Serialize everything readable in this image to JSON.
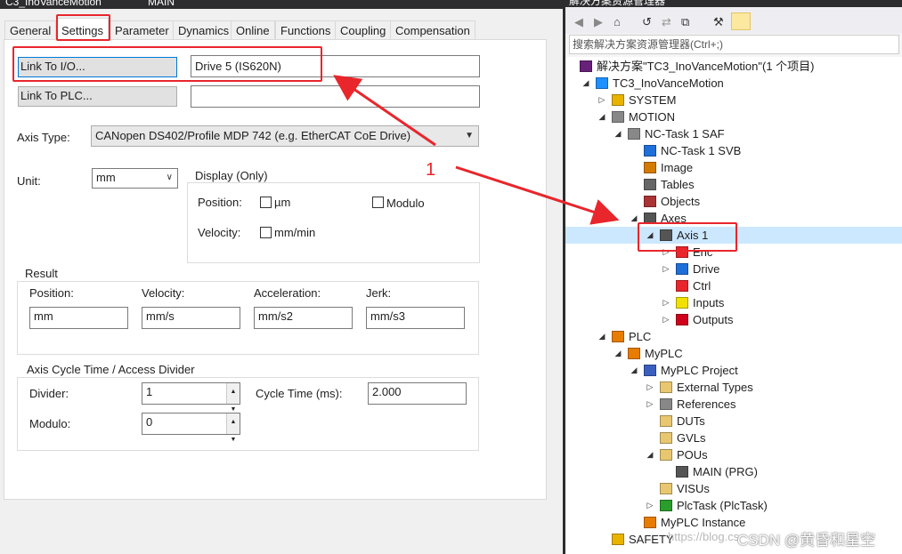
{
  "doc_tabs": [
    "C3_InoVanceMotion",
    "MAIN"
  ],
  "tabs": [
    "General",
    "Settings",
    "Parameter",
    "Dynamics",
    "Online",
    "Functions",
    "Coupling",
    "Compensation"
  ],
  "link_io": {
    "button": "Link To I/O...",
    "value": "Drive 5 (IS620N)"
  },
  "link_plc": {
    "button": "Link To PLC...",
    "value": ""
  },
  "axis_type": {
    "label": "Axis Type:",
    "value": "CANopen DS402/Profile MDP 742 (e.g. EtherCAT CoE Drive)"
  },
  "unit": {
    "label": "Unit:",
    "value": "mm"
  },
  "display": {
    "title": "Display (Only)",
    "position_label": "Position:",
    "um_label": "µm",
    "modulo_label": "Modulo",
    "velocity_label": "Velocity:",
    "mm_min_label": "mm/min"
  },
  "result": {
    "title": "Result",
    "headers": [
      "Position:",
      "Velocity:",
      "Acceleration:",
      "Jerk:"
    ],
    "values": [
      "mm",
      "mm/s",
      "mm/s2",
      "mm/s3"
    ]
  },
  "cycle": {
    "title": "Axis Cycle Time / Access Divider",
    "divider_label": "Divider:",
    "divider_value": "1",
    "cycle_time_label": "Cycle Time (ms):",
    "cycle_time_value": "2.000",
    "modulo_label": "Modulo:",
    "modulo_value": "0"
  },
  "annotation_number": "1",
  "solution_explorer": {
    "title": "解决方案资源管理器",
    "search_placeholder": "搜索解决方案资源管理器(Ctrl+;)",
    "tree": [
      {
        "label": "解决方案\"TC3_InoVanceMotion\"(1 个项目)",
        "icon": "solution-icon",
        "color": "#68217a"
      },
      {
        "label": "TC3_InoVanceMotion",
        "icon": "twincat-project-icon",
        "color": "#1e90ff"
      },
      {
        "label": "SYSTEM",
        "icon": "system-icon",
        "color": "#e8b400"
      },
      {
        "label": "MOTION",
        "icon": "motion-icon",
        "color": "#888888"
      },
      {
        "label": "NC-Task 1 SAF",
        "icon": "nc-task-icon",
        "color": "#888888"
      },
      {
        "label": "NC-Task 1 SVB",
        "icon": "nc-task-svb-icon",
        "color": "#1e6fd9"
      },
      {
        "label": "Image",
        "icon": "image-icon",
        "color": "#d47a00"
      },
      {
        "label": "Tables",
        "icon": "tables-icon",
        "color": "#666666"
      },
      {
        "label": "Objects",
        "icon": "objects-icon",
        "color": "#a33"
      },
      {
        "label": "Axes",
        "icon": "axes-icon",
        "color": "#555555"
      },
      {
        "label": "Axis 1",
        "icon": "axis-icon",
        "color": "#555555"
      },
      {
        "label": "Enc",
        "icon": "encoder-icon",
        "color": "#e8262c"
      },
      {
        "label": "Drive",
        "icon": "drive-icon",
        "color": "#1e6fd9"
      },
      {
        "label": "Ctrl",
        "icon": "ctrl-icon",
        "color": "#e8262c"
      },
      {
        "label": "Inputs",
        "icon": "inputs-icon",
        "color": "#f2e000"
      },
      {
        "label": "Outputs",
        "icon": "outputs-icon",
        "color": "#d0021b"
      },
      {
        "label": "PLC",
        "icon": "plc-icon",
        "color": "#e87c00"
      },
      {
        "label": "MyPLC",
        "icon": "myplc-icon",
        "color": "#e87c00"
      },
      {
        "label": "MyPLC Project",
        "icon": "plc-project-icon",
        "color": "#3a5fbf"
      },
      {
        "label": "External Types",
        "icon": "folder-icon",
        "color": "#e8c770"
      },
      {
        "label": "References",
        "icon": "references-icon",
        "color": "#888888"
      },
      {
        "label": "DUTs",
        "icon": "folder-icon",
        "color": "#e8c770"
      },
      {
        "label": "GVLs",
        "icon": "folder-icon",
        "color": "#e8c770"
      },
      {
        "label": "POUs",
        "icon": "folder-open-icon",
        "color": "#e8c770"
      },
      {
        "label": "MAIN (PRG)",
        "icon": "program-icon",
        "color": "#555555"
      },
      {
        "label": "VISUs",
        "icon": "folder-icon",
        "color": "#e8c770"
      },
      {
        "label": "PlcTask (PlcTask)",
        "icon": "plctask-icon",
        "color": "#2a9d2a"
      },
      {
        "label": "MyPLC Instance",
        "icon": "plc-instance-icon",
        "color": "#e87c00"
      },
      {
        "label": "SAFETY",
        "icon": "safety-icon",
        "color": "#e8b400"
      }
    ]
  },
  "watermark": "https://blog.cs",
  "csdn_credit": "CSDN @黄昏和星空"
}
